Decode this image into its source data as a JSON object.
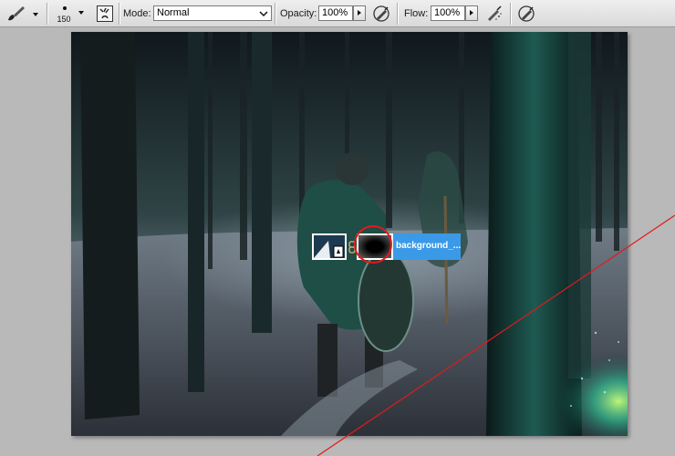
{
  "toolbar": {
    "tool_icon": "brush-icon",
    "brush_size": "150",
    "toggle_brush_panel_icon": "brush-panel-icon",
    "mode_label": "Mode:",
    "mode_value": "Normal",
    "opacity_label": "Opacity:",
    "opacity_value": "100%",
    "flow_label": "Flow:",
    "flow_value": "100%",
    "pressure_opacity_icon": "pressure-opacity-icon",
    "airbrush_icon": "airbrush-icon",
    "pressure_size_icon": "pressure-size-icon"
  },
  "canvas": {
    "drag_layer_name": "background_..."
  },
  "colors": {
    "highlight": "#3a9ae8",
    "annotation": "#e21a1a",
    "workspace": "#b9b9b9"
  }
}
